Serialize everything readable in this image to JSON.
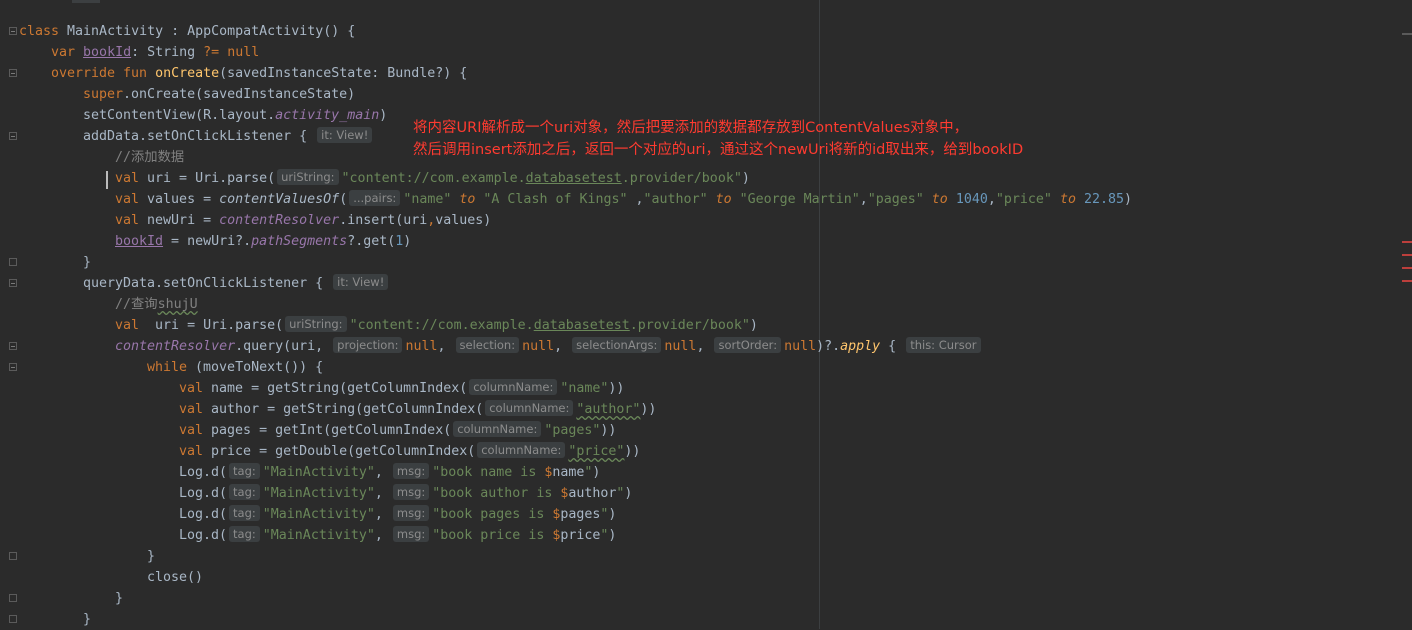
{
  "code_lines": [
    "class MainActivity : AppCompatActivity() {",
    "var bookId: String ?= null",
    "override fun onCreate(savedInstanceState: Bundle?) {",
    "super.onCreate(savedInstanceState)",
    "setContentView(R.layout.activity_main)",
    "addData.setOnClickListener {",
    "//添加数据",
    "val uri = Uri.parse(\"content://com.example.databasetest.provider/book\")",
    "val values = contentValuesOf(\"name\" to \"A Clash of Kings\" ,\"author\" to \"George Martin\",\"pages\" to 1040,\"price\" to 22.85)",
    "val newUri = contentResolver.insert(uri,values)",
    "bookId = newUri?.pathSegments?.get(1)",
    "}",
    "queryData.setOnClickListener {",
    "//查询shujU",
    "val  uri = Uri.parse(\"content://com.example.databasetest.provider/book\")",
    "contentResolver.query(uri, null, null, null, null)?.apply {",
    "while (moveToNext()) {",
    "val name = getString(getColumnIndex(\"name\"))",
    "val author = getString(getColumnIndex(\"author\"))",
    "val pages = getInt(getColumnIndex(\"pages\"))",
    "val price = getDouble(getColumnIndex(\"price\"))",
    "Log.d(\"MainActivity\",\"book name is $name\")",
    "Log.d(\"MainActivity\",\"book author is $author\")",
    "Log.d(\"MainActivity\",\"book pages is $pages\")",
    "Log.d(\"MainActivity\",\"book price is $price\")",
    "}",
    "close()",
    "}",
    "}"
  ],
  "hints": {
    "it_view": "it: View!",
    "uri_string": "uriString:",
    "pairs": "...pairs:",
    "projection": "projection:",
    "selection": "selection:",
    "selection_args": "selectionArgs:",
    "sort_order": "sortOrder:",
    "this_cursor": "this: Cursor",
    "column_name": "columnName:",
    "tag": "tag:",
    "msg": "msg:"
  },
  "annotation": {
    "line1": "将内容URI解析成一个uri对象，然后把要添加的数据都存放到ContentValues对象中，",
    "line2": "然后调用insert添加之后，返回一个对应的uri，通过这个newUri将新的id取出来，给到bookID"
  },
  "colors": {
    "background": "#2b2b2b",
    "keyword": "#cc7832",
    "function": "#ffc66d",
    "string": "#6a8759",
    "number": "#6897bb",
    "comment": "#808080",
    "property": "#9876aa",
    "text": "#a9b7c6",
    "annotation": "#ff3b30"
  }
}
